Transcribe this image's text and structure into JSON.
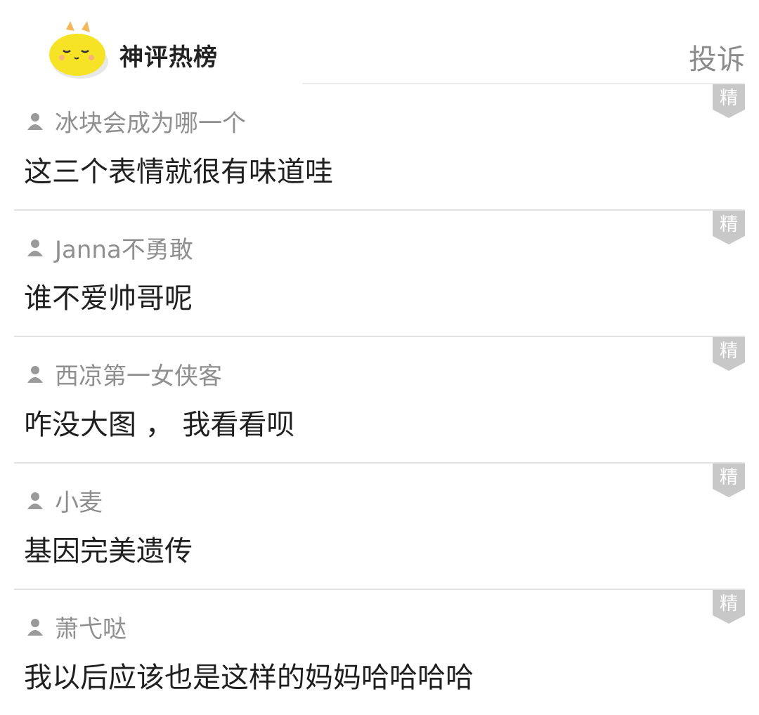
{
  "header": {
    "brand_title": "神评热榜",
    "report_label": "投诉"
  },
  "badge_label": "精",
  "comments": [
    {
      "username": "冰块会成为哪一个",
      "text": "这三个表情就很有味道哇"
    },
    {
      "username": "Janna不勇敢",
      "text": "谁不爱帅哥呢"
    },
    {
      "username": "西凉第一女侠客",
      "text": "咋没大图 ， 我看看呗"
    },
    {
      "username": "小麦",
      "text": "基因完美遗传"
    },
    {
      "username": "萧弋哒",
      "text": "我以后应该也是这样的妈妈哈哈哈哈"
    }
  ],
  "colors": {
    "mascot": "#f7e326",
    "badge": "#c8c8c8",
    "divider": "#e2e2e2"
  }
}
